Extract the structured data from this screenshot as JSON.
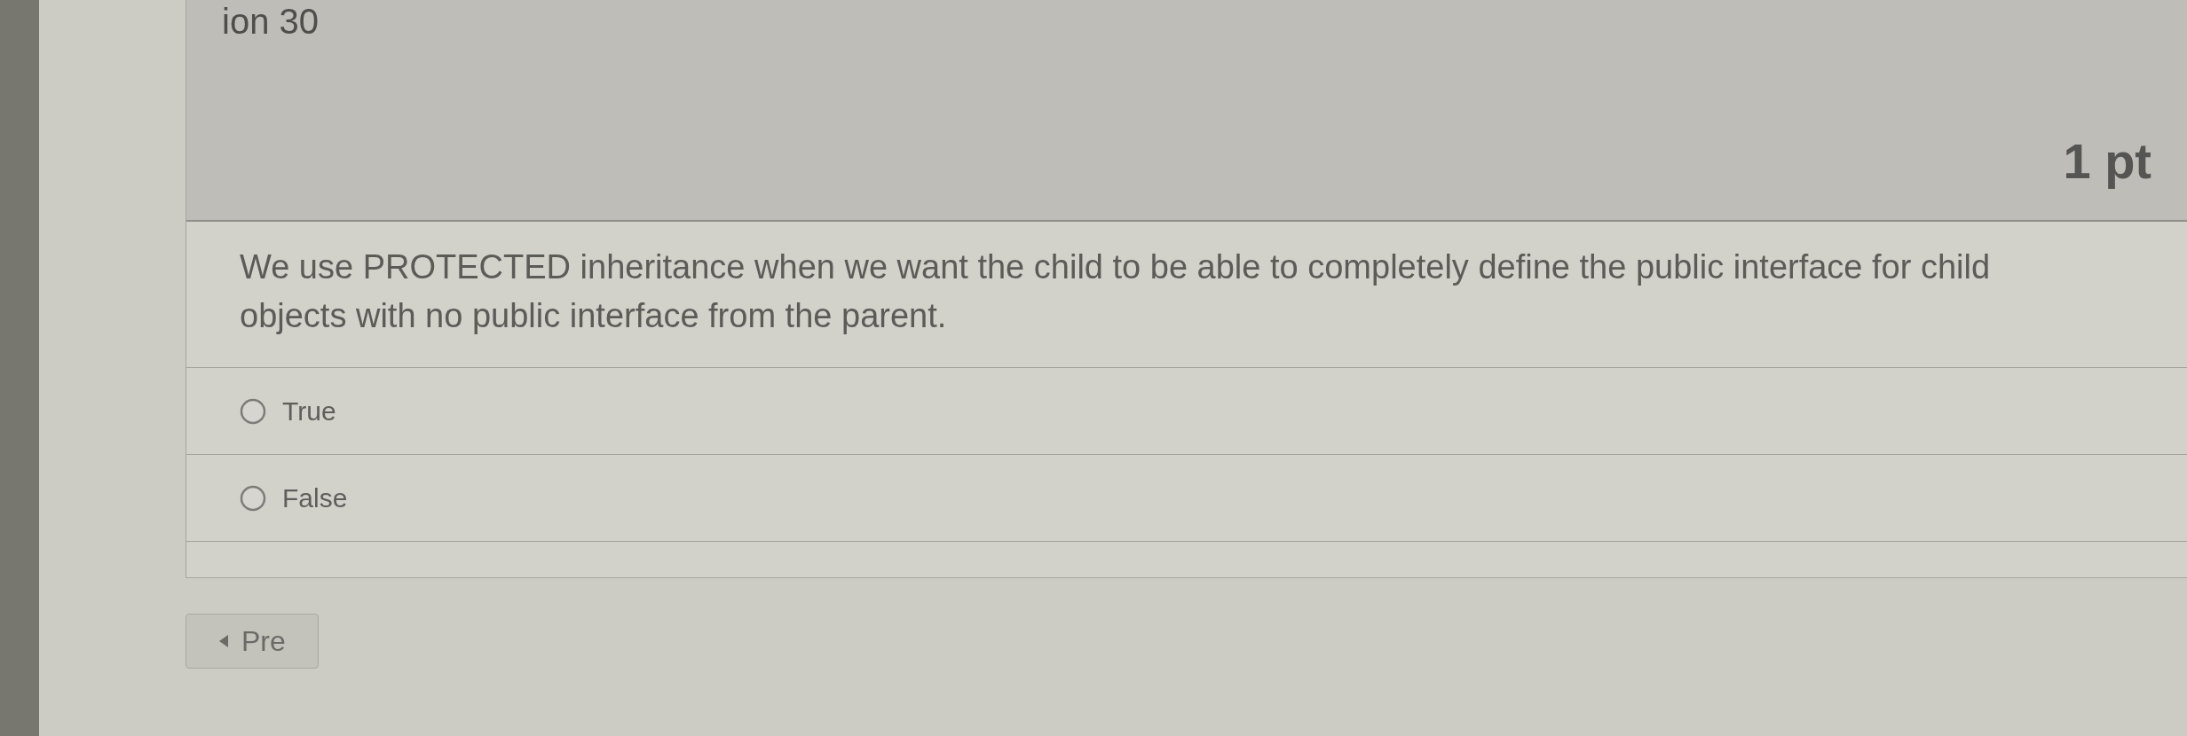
{
  "question": {
    "title": "ion 30",
    "points": "1 pt",
    "text": "We use PROTECTED inheritance when we want the child to be able to completely define the public interface for child objects with no public interface from the parent.",
    "answers": [
      {
        "label": "True",
        "selected": false
      },
      {
        "label": "False",
        "selected": false
      }
    ]
  },
  "navigation": {
    "previous_button": "Pre"
  }
}
